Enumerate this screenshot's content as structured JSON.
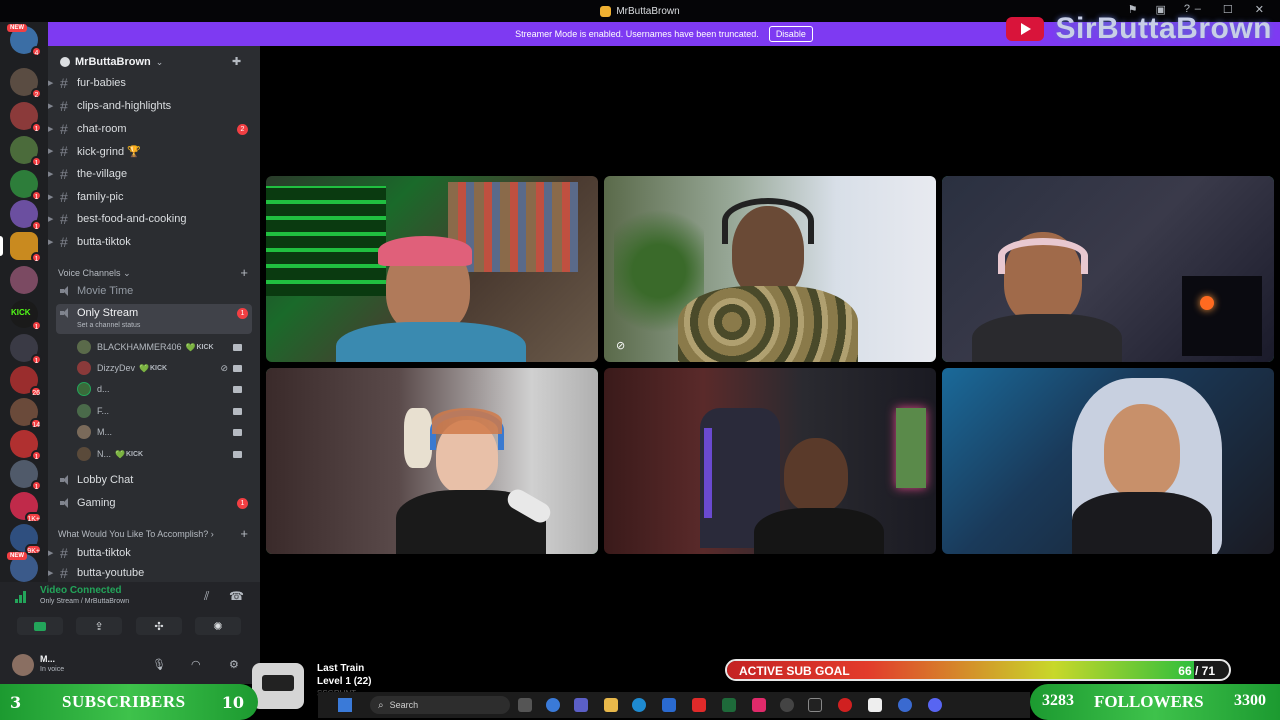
{
  "window": {
    "title": "MrButtaBrown"
  },
  "banner": {
    "message": "Streamer Mode is enabled. Usernames have been truncated.",
    "disable_label": "Disable"
  },
  "brand": {
    "name": "SirButtaBrown"
  },
  "server_rail": {
    "new_label": "NEW",
    "kick_label": "KICK",
    "badges": [
      "4",
      "2",
      "1",
      "1",
      "1",
      "1",
      "1",
      "1",
      "1",
      "26",
      "14",
      "1",
      "1",
      "1K+",
      "9K+"
    ]
  },
  "guild": {
    "name": "MrButtaBrown"
  },
  "channels_top": [
    {
      "name": "fur-babies"
    },
    {
      "name": "clips-and-highlights"
    },
    {
      "name": "chat-room",
      "mentions": "2"
    },
    {
      "name": "kick-grind 🏆"
    },
    {
      "name": "the-village"
    },
    {
      "name": "family-pic"
    },
    {
      "name": "best-food-and-cooking"
    },
    {
      "name": "butta-tiktok"
    }
  ],
  "voice_category": "Voice Channels",
  "voice_channels": {
    "movie_time": "Movie Time",
    "only_stream": "Only Stream",
    "only_stream_status": "Set a channel status",
    "only_stream_mentions": "1",
    "lobby": "Lobby Chat",
    "gaming": "Gaming",
    "gaming_mentions": "1"
  },
  "voice_users": [
    {
      "name": "BLACKHAMMER406",
      "heart": "💚",
      "tag": "KICK"
    },
    {
      "name": "DizzyDev",
      "heart": "💚",
      "tag": "KICK"
    },
    {
      "name": "d..."
    },
    {
      "name": "F..."
    },
    {
      "name": "M..."
    },
    {
      "name": "N...",
      "heart": "💚",
      "tag": "KICK"
    }
  ],
  "category2": "What Would You Like To Accomplish?",
  "channels_bottom": [
    {
      "name": "butta-tiktok"
    },
    {
      "name": "butta-youtube"
    }
  ],
  "voice_panel": {
    "title": "Video Connected",
    "subtitle": "Only Stream / MrButtaBrown"
  },
  "user": {
    "name": "M...",
    "status": "In voice"
  },
  "overlay": {
    "subs_left": "3",
    "subs_label": "SUBSCRIBERS",
    "subs_right": "10",
    "followers_left": "3283",
    "followers_label": "FOLLOWERS",
    "followers_right": "3300",
    "goal_label": "ACTIVE SUB GOAL",
    "goal_count": "66 / 71",
    "goal_fraction": 0.93,
    "song": "Last Train",
    "level": "Level 1 (22)",
    "ghost_text": "SSGRUNT..."
  },
  "taskbar": {
    "search_placeholder": "Search"
  },
  "colors": {
    "accent": "#7e3af2",
    "speaking": "#23a55a",
    "mention": "#f23f43"
  }
}
